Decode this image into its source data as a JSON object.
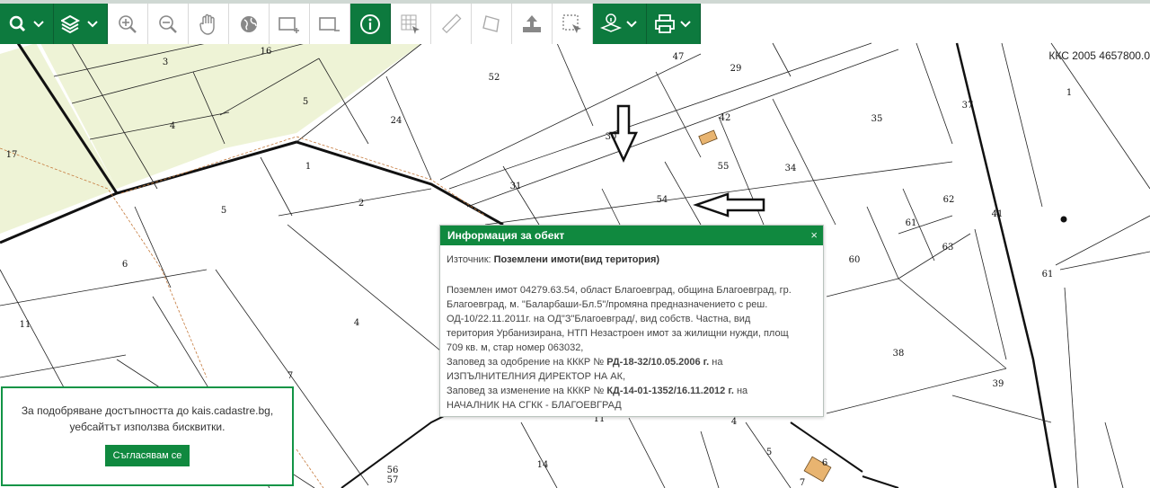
{
  "toolbar": {
    "buttons": [
      {
        "name": "search-button",
        "icon": "search-icon",
        "dropdown": true
      },
      {
        "name": "layers-button",
        "icon": "layers-icon",
        "dropdown": true
      },
      {
        "name": "zoom-in-button",
        "icon": "zoom-in-icon"
      },
      {
        "name": "zoom-out-button",
        "icon": "zoom-out-icon"
      },
      {
        "name": "pan-button",
        "icon": "hand-icon"
      },
      {
        "name": "full-extent-button",
        "icon": "globe-icon"
      },
      {
        "name": "zoom-box-in-button",
        "icon": "zoom-box-in-icon"
      },
      {
        "name": "zoom-box-out-button",
        "icon": "zoom-box-out-icon"
      },
      {
        "name": "info-button",
        "icon": "info-icon",
        "active": true
      },
      {
        "name": "measure-coords-button",
        "icon": "grid-pointer-icon"
      },
      {
        "name": "measure-distance-button",
        "icon": "ruler-icon"
      },
      {
        "name": "measure-area-button",
        "icon": "polygon-icon"
      },
      {
        "name": "upload-button",
        "icon": "upload-icon"
      },
      {
        "name": "select-area-button",
        "icon": "select-box-icon"
      },
      {
        "name": "info-layers-button",
        "icon": "info-layers-icon",
        "dropdown": true
      },
      {
        "name": "print-button",
        "icon": "printer-icon",
        "dropdown": true
      }
    ]
  },
  "coordinates": "ККС 2005 4657800.0",
  "map_labels": [
    "3",
    "16",
    "52",
    "47",
    "29",
    "1",
    "4",
    "5",
    "24",
    "42",
    "35",
    "37",
    "17",
    "1",
    "30",
    "31",
    "55",
    "34",
    "5",
    "2",
    "54",
    "62",
    "41",
    "61",
    "63",
    "6",
    "60",
    "61",
    "11",
    "4",
    "38",
    "7",
    "39",
    "11",
    "4",
    "5",
    "14",
    "56",
    "57",
    "6",
    "7"
  ],
  "popup": {
    "title": "Информация за обект",
    "close_label": "×",
    "source_label": "Източник:",
    "source_value": "Поземлени имоти(вид територия)",
    "lines": [
      "Поземлен имот 04279.63.54, област Благоевград, община Благоевград, гр.",
      "Благоевград, м. \"Баларбаши-Бл.5\"/промяна предназначението с реш.",
      "ОД-10/22.11.2011г. на ОД\"З\"Благоевград/, вид собств. Частна, вид",
      "територия Урбанизирана, НТП Незастроен имот за жилищни нужди, площ",
      "709 кв. м, стар номер 063032,"
    ],
    "order1_prefix": "Заповед за одобрение на КККР №",
    "order1_value": "РД-18-32/10.05.2006 г.",
    "order1_suffix": "на",
    "order1_line2": "ИЗПЪЛНИТЕЛНИЯ ДИРЕКТОР НА АК,",
    "order2_prefix": "Заповед за изменение на КККР №",
    "order2_value": "КД-14-01-1352/16.11.2012 г.",
    "order2_suffix": "на",
    "order2_line2": "НАЧАЛНИК НА СГКК - БЛАГОЕВГРАД"
  },
  "cookie": {
    "line1": "За подобряване достъпността до kais.cadastre.bg,",
    "line2": "уебсайтът използва бисквитки.",
    "button": "Съгласявам се"
  },
  "colors": {
    "accent": "#10893f",
    "map_green": "#eef3d6"
  }
}
